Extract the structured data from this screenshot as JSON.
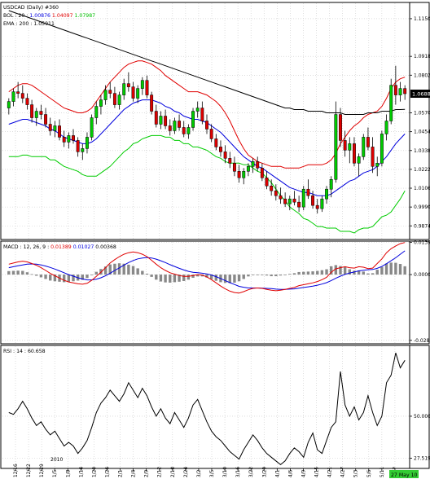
{
  "chart_data": [
    {
      "type": "candlestick",
      "panel": "price",
      "legend": [
        {
          "text": "USDCAD (Daily) #360",
          "color": "#000000"
        },
        {
          "text": "BOL : 20 : 1.00876 1.04097 1.07987",
          "color": "#e00000",
          "parts": [
            {
              "text": "BOL : 20 : ",
              "color": "#000000"
            },
            {
              "text": "1.00876",
              "color": "#0000e0"
            },
            {
              "text": " 1.04097 ",
              "color": "#e00000"
            },
            {
              "text": "1.07987",
              "color": "#00c000"
            }
          ]
        },
        {
          "text": "EMA : 200 : 1.05911",
          "color": "#000000"
        }
      ],
      "ylim": [
        0.979,
        1.125
      ],
      "yticks": [
        "1.1150",
        "1.0918",
        "1.0802",
        "1.0570",
        "1.0454",
        "1.0338",
        "1.0222",
        "1.0106",
        "0.9990",
        "0.9874"
      ],
      "current_price": "1.0688",
      "ohlc": [
        [
          1.06,
          1.066,
          1.056,
          1.064
        ],
        [
          1.064,
          1.072,
          1.061,
          1.07
        ],
        [
          1.07,
          1.076,
          1.066,
          1.069
        ],
        [
          1.069,
          1.074,
          1.063,
          1.066
        ],
        [
          1.066,
          1.069,
          1.059,
          1.062
        ],
        [
          1.062,
          1.065,
          1.051,
          1.054
        ],
        [
          1.054,
          1.06,
          1.049,
          1.058
        ],
        [
          1.058,
          1.062,
          1.053,
          1.056
        ],
        [
          1.056,
          1.06,
          1.048,
          1.05
        ],
        [
          1.05,
          1.054,
          1.043,
          1.046
        ],
        [
          1.046,
          1.052,
          1.042,
          1.049
        ],
        [
          1.049,
          1.053,
          1.04,
          1.042
        ],
        [
          1.042,
          1.046,
          1.036,
          1.039
        ],
        [
          1.039,
          1.045,
          1.035,
          1.043
        ],
        [
          1.043,
          1.047,
          1.038,
          1.04
        ],
        [
          1.04,
          1.042,
          1.03,
          1.033
        ],
        [
          1.033,
          1.038,
          1.028,
          1.035
        ],
        [
          1.035,
          1.045,
          1.032,
          1.042
        ],
        [
          1.042,
          1.056,
          1.04,
          1.054
        ],
        [
          1.054,
          1.064,
          1.05,
          1.061
        ],
        [
          1.061,
          1.068,
          1.056,
          1.065
        ],
        [
          1.065,
          1.074,
          1.062,
          1.071
        ],
        [
          1.071,
          1.076,
          1.066,
          1.069
        ],
        [
          1.069,
          1.073,
          1.06,
          1.062
        ],
        [
          1.062,
          1.07,
          1.059,
          1.068
        ],
        [
          1.068,
          1.078,
          1.065,
          1.075
        ],
        [
          1.075,
          1.082,
          1.07,
          1.073
        ],
        [
          1.073,
          1.076,
          1.064,
          1.066
        ],
        [
          1.066,
          1.074,
          1.063,
          1.072
        ],
        [
          1.072,
          1.079,
          1.068,
          1.077
        ],
        [
          1.077,
          1.08,
          1.066,
          1.068
        ],
        [
          1.068,
          1.07,
          1.056,
          1.058
        ],
        [
          1.058,
          1.062,
          1.048,
          1.05
        ],
        [
          1.05,
          1.058,
          1.047,
          1.055
        ],
        [
          1.055,
          1.059,
          1.047,
          1.049
        ],
        [
          1.049,
          1.053,
          1.043,
          1.046
        ],
        [
          1.046,
          1.054,
          1.044,
          1.052
        ],
        [
          1.052,
          1.056,
          1.046,
          1.048
        ],
        [
          1.048,
          1.052,
          1.042,
          1.044
        ],
        [
          1.044,
          1.05,
          1.041,
          1.048
        ],
        [
          1.048,
          1.06,
          1.046,
          1.058
        ],
        [
          1.058,
          1.064,
          1.054,
          1.06
        ],
        [
          1.06,
          1.064,
          1.05,
          1.052
        ],
        [
          1.052,
          1.056,
          1.044,
          1.047
        ],
        [
          1.047,
          1.05,
          1.039,
          1.041
        ],
        [
          1.041,
          1.044,
          1.034,
          1.036
        ],
        [
          1.036,
          1.04,
          1.03,
          1.033
        ],
        [
          1.033,
          1.037,
          1.026,
          1.029
        ],
        [
          1.029,
          1.033,
          1.023,
          1.026
        ],
        [
          1.026,
          1.03,
          1.018,
          1.021
        ],
        [
          1.021,
          1.025,
          1.014,
          1.017
        ],
        [
          1.017,
          1.023,
          1.013,
          1.021
        ],
        [
          1.021,
          1.026,
          1.018,
          1.024
        ],
        [
          1.024,
          1.029,
          1.02,
          1.027
        ],
        [
          1.027,
          1.03,
          1.021,
          1.023
        ],
        [
          1.023,
          1.026,
          1.015,
          1.017
        ],
        [
          1.017,
          1.021,
          1.01,
          1.012
        ],
        [
          1.012,
          1.016,
          1.006,
          1.009
        ],
        [
          1.009,
          1.013,
          1.003,
          1.006
        ],
        [
          1.006,
          1.011,
          1.001,
          1.004
        ],
        [
          1.004,
          1.008,
          0.999,
          1.001
        ],
        [
          1.001,
          1.006,
          0.997,
          1.004
        ],
        [
          1.004,
          1.009,
          1.0,
          1.002
        ],
        [
          1.002,
          1.006,
          0.996,
          0.999
        ],
        [
          0.999,
          1.012,
          0.997,
          1.01
        ],
        [
          1.01,
          1.016,
          1.004,
          1.006
        ],
        [
          1.006,
          1.009,
          0.998,
          1.0
        ],
        [
          1.0,
          1.004,
          0.995,
          0.998
        ],
        [
          0.998,
          1.006,
          0.996,
          1.004
        ],
        [
          1.004,
          1.012,
          1.001,
          1.01
        ],
        [
          1.01,
          1.018,
          1.005,
          1.016
        ],
        [
          1.016,
          1.064,
          1.014,
          1.056
        ],
        [
          1.056,
          1.06,
          1.036,
          1.04
        ],
        [
          1.04,
          1.046,
          1.03,
          1.034
        ],
        [
          1.034,
          1.042,
          1.026,
          1.038
        ],
        [
          1.038,
          1.042,
          1.024,
          1.026
        ],
        [
          1.026,
          1.032,
          1.018,
          1.03
        ],
        [
          1.03,
          1.044,
          1.028,
          1.042
        ],
        [
          1.042,
          1.048,
          1.034,
          1.036
        ],
        [
          1.036,
          1.042,
          1.02,
          1.024
        ],
        [
          1.024,
          1.03,
          1.018,
          1.026
        ],
        [
          1.026,
          1.046,
          1.024,
          1.044
        ],
        [
          1.044,
          1.056,
          1.04,
          1.052
        ],
        [
          1.052,
          1.078,
          1.05,
          1.074
        ],
        [
          1.074,
          1.086,
          1.062,
          1.068
        ],
        [
          1.068,
          1.076,
          1.064,
          1.072
        ],
        [
          1.072,
          1.074,
          1.065,
          1.0688
        ]
      ],
      "bands": {
        "upper": [
          1.07,
          1.072,
          1.074,
          1.075,
          1.075,
          1.074,
          1.072,
          1.07,
          1.068,
          1.066,
          1.064,
          1.062,
          1.06,
          1.059,
          1.058,
          1.057,
          1.057,
          1.058,
          1.06,
          1.064,
          1.068,
          1.072,
          1.076,
          1.079,
          1.082,
          1.085,
          1.087,
          1.088,
          1.089,
          1.089,
          1.088,
          1.087,
          1.085,
          1.083,
          1.08,
          1.078,
          1.076,
          1.074,
          1.072,
          1.07,
          1.07,
          1.07,
          1.069,
          1.068,
          1.066,
          1.064,
          1.061,
          1.057,
          1.052,
          1.046,
          1.04,
          1.035,
          1.031,
          1.029,
          1.027,
          1.026,
          1.025,
          1.024,
          1.024,
          1.024,
          1.023,
          1.023,
          1.023,
          1.023,
          1.024,
          1.025,
          1.025,
          1.025,
          1.025,
          1.026,
          1.028,
          1.032,
          1.038,
          1.042,
          1.046,
          1.049,
          1.051,
          1.054,
          1.056,
          1.057,
          1.058,
          1.061,
          1.066,
          1.072,
          1.076,
          1.078,
          1.079
        ],
        "middle": [
          1.05,
          1.051,
          1.052,
          1.053,
          1.053,
          1.052,
          1.051,
          1.05,
          1.049,
          1.047,
          1.046,
          1.044,
          1.042,
          1.041,
          1.04,
          1.039,
          1.038,
          1.038,
          1.039,
          1.041,
          1.044,
          1.047,
          1.05,
          1.053,
          1.056,
          1.059,
          1.061,
          1.063,
          1.064,
          1.065,
          1.065,
          1.065,
          1.064,
          1.063,
          1.061,
          1.06,
          1.058,
          1.057,
          1.055,
          1.054,
          1.053,
          1.053,
          1.052,
          1.051,
          1.049,
          1.047,
          1.045,
          1.042,
          1.039,
          1.036,
          1.033,
          1.03,
          1.028,
          1.026,
          1.024,
          1.023,
          1.021,
          1.019,
          1.017,
          1.015,
          1.013,
          1.011,
          1.01,
          1.009,
          1.008,
          1.008,
          1.007,
          1.006,
          1.006,
          1.006,
          1.007,
          1.009,
          1.011,
          1.013,
          1.015,
          1.016,
          1.018,
          1.02,
          1.021,
          1.022,
          1.024,
          1.027,
          1.03,
          1.034,
          1.038,
          1.041,
          1.044
        ],
        "lower": [
          1.03,
          1.03,
          1.03,
          1.031,
          1.031,
          1.03,
          1.03,
          1.03,
          1.03,
          1.028,
          1.028,
          1.026,
          1.024,
          1.023,
          1.022,
          1.021,
          1.019,
          1.018,
          1.018,
          1.018,
          1.02,
          1.022,
          1.024,
          1.027,
          1.03,
          1.033,
          1.035,
          1.038,
          1.039,
          1.041,
          1.042,
          1.043,
          1.043,
          1.043,
          1.042,
          1.042,
          1.04,
          1.04,
          1.038,
          1.038,
          1.036,
          1.036,
          1.035,
          1.034,
          1.032,
          1.03,
          1.029,
          1.027,
          1.026,
          1.026,
          1.026,
          1.025,
          1.025,
          1.023,
          1.021,
          1.02,
          1.017,
          1.014,
          1.01,
          1.006,
          1.003,
          0.999,
          0.997,
          0.995,
          0.992,
          0.991,
          0.989,
          0.987,
          0.987,
          0.986,
          0.986,
          0.986,
          0.984,
          0.984,
          0.984,
          0.983,
          0.985,
          0.986,
          0.986,
          0.987,
          0.99,
          0.993,
          0.994,
          0.996,
          1.0,
          1.004,
          1.009
        ]
      },
      "ema200": [
        1.12,
        1.119,
        1.118,
        1.117,
        1.116,
        1.115,
        1.114,
        1.113,
        1.112,
        1.111,
        1.11,
        1.109,
        1.108,
        1.107,
        1.106,
        1.105,
        1.104,
        1.103,
        1.102,
        1.101,
        1.1,
        1.099,
        1.098,
        1.097,
        1.096,
        1.095,
        1.094,
        1.093,
        1.092,
        1.091,
        1.09,
        1.089,
        1.088,
        1.087,
        1.086,
        1.085,
        1.084,
        1.083,
        1.082,
        1.081,
        1.08,
        1.079,
        1.078,
        1.077,
        1.076,
        1.075,
        1.074,
        1.073,
        1.072,
        1.071,
        1.07,
        1.069,
        1.068,
        1.067,
        1.066,
        1.065,
        1.064,
        1.063,
        1.062,
        1.061,
        1.06,
        1.06,
        1.059,
        1.059,
        1.059,
        1.058,
        1.058,
        1.058,
        1.058,
        1.057,
        1.057,
        1.057,
        1.057,
        1.056,
        1.056,
        1.056,
        1.056,
        1.056,
        1.057,
        1.057,
        1.057,
        1.058,
        1.058,
        1.058,
        1.059,
        1.059,
        1.0591
      ]
    },
    {
      "type": "macd",
      "panel": "macd",
      "legend_parts": [
        {
          "text": "MACD : 12, 26, 9 : ",
          "color": "#000000"
        },
        {
          "text": "0.01389",
          "color": "#e00000"
        },
        {
          "text": " 0.01027 ",
          "color": "#0000e0"
        },
        {
          "text": "0.00368",
          "color": "#000000"
        }
      ],
      "ylim": [
        -0.03,
        0.0145
      ],
      "yticks": [
        "0.01393",
        "0.00000",
        "-0.02851"
      ],
      "macd": [
        0.0045,
        0.005,
        0.0055,
        0.0058,
        0.0055,
        0.0048,
        0.004,
        0.003,
        0.0018,
        0.0005,
        -0.0005,
        -0.0015,
        -0.0025,
        -0.0032,
        -0.0036,
        -0.004,
        -0.0042,
        -0.0038,
        -0.0025,
        -0.0008,
        0.001,
        0.003,
        0.005,
        0.0065,
        0.0078,
        0.0088,
        0.0095,
        0.0098,
        0.0095,
        0.0088,
        0.0078,
        0.0062,
        0.0045,
        0.003,
        0.0018,
        0.0008,
        0.0002,
        -0.0004,
        -0.0008,
        -0.0008,
        -0.0004,
        0.0,
        -0.0002,
        -0.001,
        -0.0022,
        -0.0036,
        -0.005,
        -0.0062,
        -0.0072,
        -0.0078,
        -0.008,
        -0.0074,
        -0.0066,
        -0.006,
        -0.0058,
        -0.006,
        -0.0064,
        -0.0068,
        -0.007,
        -0.0068,
        -0.0064,
        -0.006,
        -0.0056,
        -0.0048,
        -0.0044,
        -0.004,
        -0.0036,
        -0.003,
        -0.0022,
        -0.0012,
        0.001,
        0.0025,
        0.003,
        0.0034,
        0.003,
        0.0028,
        0.0034,
        0.0032,
        0.0026,
        0.0028,
        0.0048,
        0.0068,
        0.0095,
        0.0112,
        0.0124,
        0.0134,
        0.0139
      ],
      "signal": [
        0.003,
        0.0034,
        0.0038,
        0.0042,
        0.0045,
        0.0046,
        0.0045,
        0.0042,
        0.0037,
        0.0031,
        0.0024,
        0.0016,
        0.0008,
        0.0,
        -0.0007,
        -0.0014,
        -0.0019,
        -0.0023,
        -0.0023,
        -0.002,
        -0.0014,
        -0.0005,
        0.0006,
        0.0018,
        0.0029,
        0.0041,
        0.0052,
        0.0061,
        0.0068,
        0.0072,
        0.0074,
        0.0072,
        0.0067,
        0.006,
        0.0052,
        0.0043,
        0.0035,
        0.0027,
        0.002,
        0.0014,
        0.001,
        0.0008,
        0.0006,
        0.0003,
        -0.0002,
        -0.0009,
        -0.0017,
        -0.0026,
        -0.0035,
        -0.0043,
        -0.0051,
        -0.0055,
        -0.0058,
        -0.0058,
        -0.0058,
        -0.0059,
        -0.006,
        -0.0061,
        -0.0063,
        -0.0064,
        -0.0064,
        -0.0063,
        -0.0062,
        -0.0059,
        -0.0056,
        -0.0053,
        -0.005,
        -0.0046,
        -0.0041,
        -0.0035,
        -0.0026,
        -0.0016,
        -0.0007,
        0.0001,
        0.0007,
        0.0011,
        0.0016,
        0.0019,
        0.0021,
        0.0022,
        0.0027,
        0.0035,
        0.0047,
        0.006,
        0.0073,
        0.0088,
        0.0103
      ]
    },
    {
      "type": "line",
      "panel": "rsi",
      "legend": "RSI : 14 : 60.658",
      "ylim": [
        22,
        88
      ],
      "yticks": [
        "50.000",
        "27.519"
      ],
      "values": [
        52,
        51,
        54,
        58,
        54,
        49,
        45,
        47,
        43,
        40,
        42,
        38,
        34,
        36,
        34,
        30,
        33,
        37,
        44,
        52,
        57,
        60,
        64,
        61,
        58,
        62,
        68,
        64,
        60,
        65,
        61,
        55,
        50,
        54,
        49,
        46,
        52,
        48,
        44,
        49,
        56,
        59,
        53,
        47,
        42,
        39,
        37,
        34,
        31,
        29,
        27,
        32,
        36,
        40,
        37,
        33,
        30,
        28,
        26,
        24,
        26,
        30,
        33,
        31,
        28,
        36,
        41,
        32,
        30,
        37,
        44,
        47,
        74,
        56,
        50,
        55,
        48,
        52,
        61,
        52,
        45,
        50,
        68,
        72,
        84,
        76,
        80
      ]
    },
    {
      "type": "axis",
      "panel": "x-axis",
      "date_labels": [
        "12/16",
        "12/22",
        "12/29",
        "1/5",
        "1/8",
        "1/14",
        "1/20",
        "1/26",
        "2/1",
        "2/4",
        "2/9",
        "2/12",
        "2/18",
        "2/24",
        "3/2",
        "3/5",
        "3/10",
        "3/16",
        "3/22",
        "3/29",
        "4/1",
        "4/6",
        "4/9",
        "4/15",
        "4/21",
        "4/27",
        "5/3",
        "5/6",
        "5/11",
        "5/17"
      ],
      "year_label": "2010",
      "current_date": "27 May 10"
    }
  ]
}
